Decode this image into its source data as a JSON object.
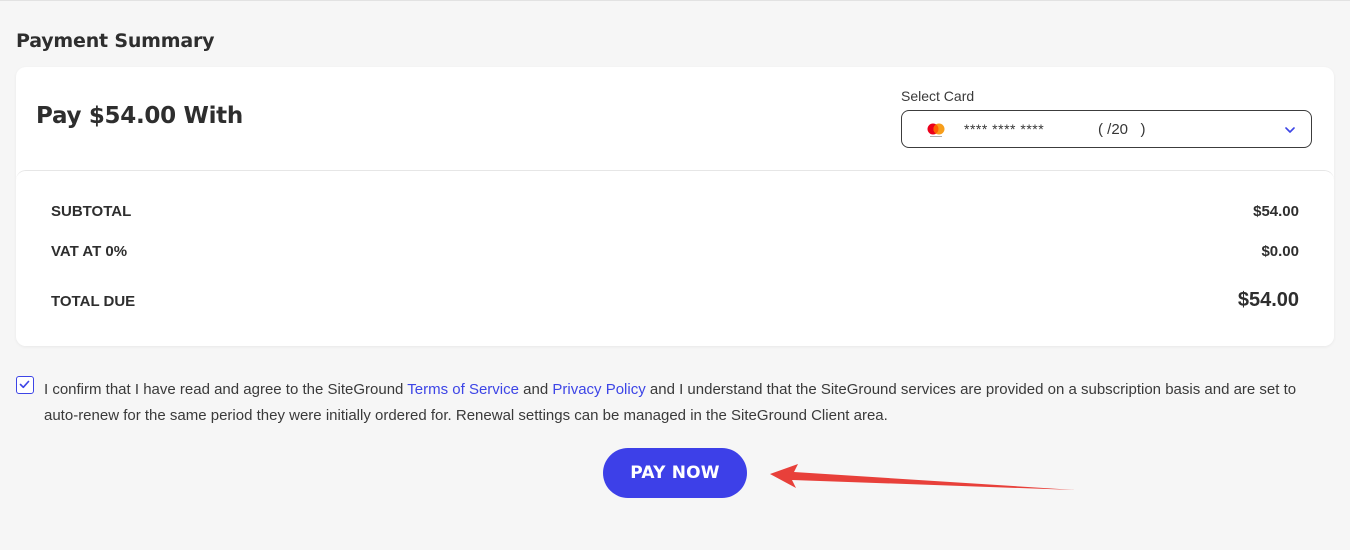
{
  "section_title": "Payment Summary",
  "payment": {
    "title": "Pay $54.00 With",
    "select_label": "Select Card",
    "card_brand_icon": "mastercard-icon",
    "card_number_masked": "**** **** ****",
    "card_expiry": "( /20   )"
  },
  "summary": {
    "rows": [
      {
        "label": "SUBTOTAL",
        "value": "$54.00"
      },
      {
        "label": "VAT AT 0%",
        "value": "$0.00"
      },
      {
        "label": "TOTAL DUE",
        "value": "$54.00"
      }
    ]
  },
  "consent": {
    "checked": true,
    "text_before": "I confirm that I have read and agree to the SiteGround ",
    "terms_link": "Terms of Service",
    "text_middle": " and ",
    "privacy_link": "Privacy Policy",
    "text_after": " and I understand that the SiteGround services are provided on a subscription basis and are set to auto-renew for the same period they were initially ordered for. Renewal settings can be managed in the SiteGround Client area."
  },
  "pay_button": {
    "label": "PAY NOW"
  },
  "colors": {
    "accent": "#3d40e8",
    "link": "#3d45e6",
    "annotation_arrow": "#e8403a",
    "background": "#f6f6f6"
  }
}
